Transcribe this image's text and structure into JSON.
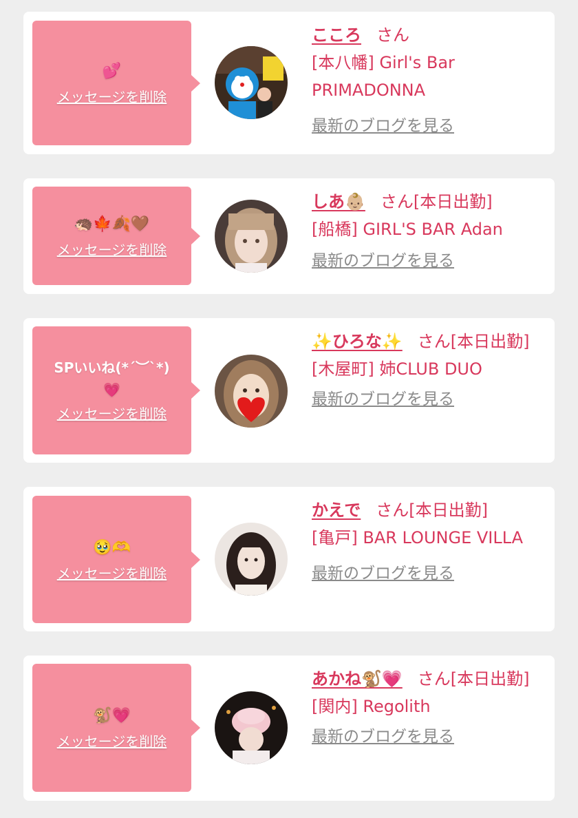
{
  "delete_label": "メッセージを削除",
  "blog_label": "最新のブログを見る",
  "colors": {
    "accent": "#d8385c",
    "bubble": "#f58f9e",
    "link": "#8a8a8a"
  },
  "cards": [
    {
      "message": "💕",
      "name": "こころ",
      "honorific": "さん",
      "status": "",
      "shop": "[本八幡] Girl's Bar PRIMADONNA"
    },
    {
      "message": "🦔🍁🍂🤎",
      "name": "しあ👶🏼",
      "honorific": "さん",
      "status": "[本日出勤]",
      "shop": "[船橋] GIRL'S BAR Adan"
    },
    {
      "message": "SPいいね(*´︶`*)💗",
      "name": "✨ひろな✨",
      "honorific": "さん",
      "status": "[本日出勤]",
      "shop": "[木屋町] 姉CLUB DUO"
    },
    {
      "message": "🥹🫶",
      "name": "かえで",
      "honorific": "さん",
      "status": "[本日出勤]",
      "shop": "[亀戸] BAR LOUNGE VILLA"
    },
    {
      "message": "🐒💗",
      "name": "あかね🐒💗",
      "honorific": "さん",
      "status": "[本日出勤]",
      "shop": "[関内] Regolith"
    }
  ]
}
